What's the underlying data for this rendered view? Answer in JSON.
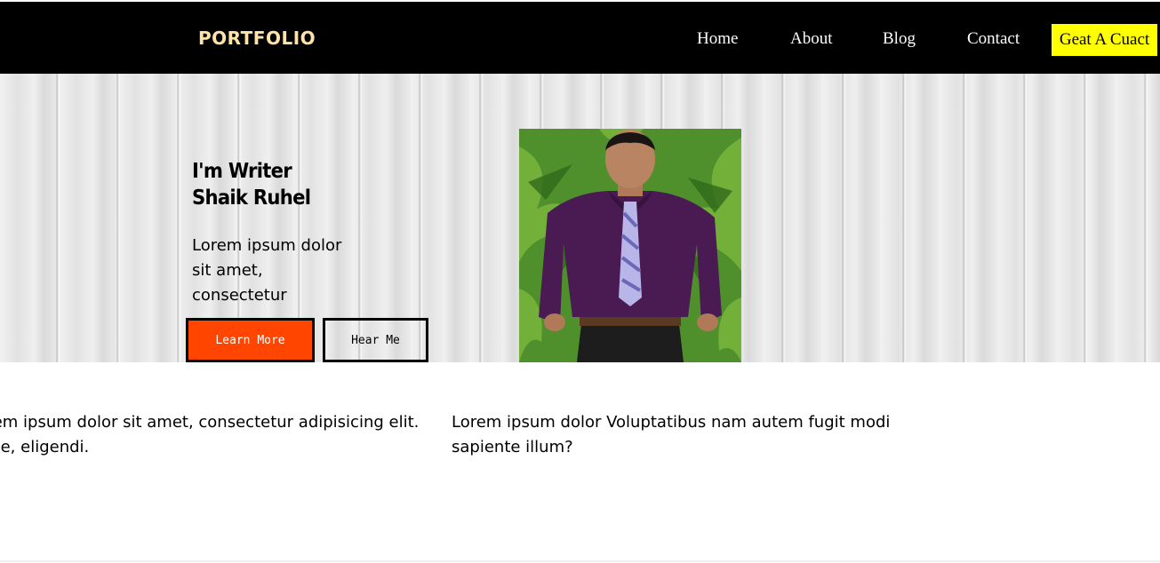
{
  "navbar": {
    "brand": "PORTFOLIO",
    "links": [
      "Home",
      "About",
      "Blog",
      "Contact"
    ],
    "cta": "Geat A Cuact"
  },
  "hero": {
    "title_line1": "I'm Writer",
    "title_line2": "Shaik Ruhel",
    "text": "Lorem ipsum dolor sit amet, consectetur",
    "learn_more": "Learn More",
    "hear_me": "Hear Me"
  },
  "about": {
    "left_text": "Lorem ipsum dolor sit amet, consectetur adipisicing elit. Quae, eligendi.",
    "right_text": "Lorem ipsum dolor Voluptatibus nam autem fugit modi sapiente illum?"
  },
  "colors": {
    "navbar_bg": "#000000",
    "brand": "#ffe4a8",
    "cta_bg": "#ffff00",
    "learn_more_bg": "#ff4500"
  }
}
